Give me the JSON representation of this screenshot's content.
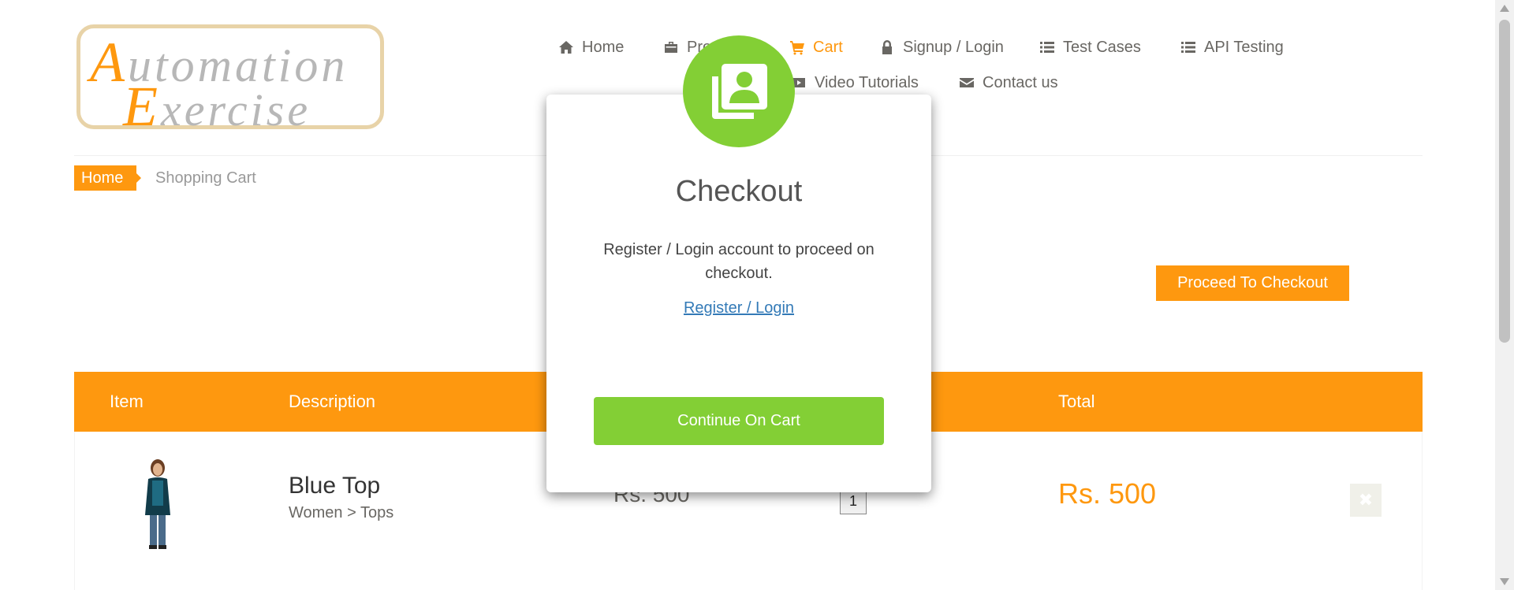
{
  "logo": {
    "line1_cap": "A",
    "line1_rest": "utomation",
    "line2_cap": "E",
    "line2_rest": "xercise"
  },
  "nav": {
    "home": "Home",
    "products": "Products",
    "cart": "Cart",
    "signup_login": "Signup / Login",
    "test_cases": "Test Cases",
    "api_testing": "API Testing",
    "video_tutorials": "Video Tutorials",
    "contact_us": "Contact us"
  },
  "breadcrumb": {
    "home": "Home",
    "current": "Shopping Cart"
  },
  "proceed_button": "Proceed To Checkout",
  "table": {
    "headers": {
      "item": "Item",
      "description": "Description",
      "total": "Total"
    },
    "rows": [
      {
        "name": "Blue Top",
        "category": "Women > Tops",
        "price": "Rs. 500",
        "quantity": "1",
        "total": "Rs. 500"
      }
    ]
  },
  "modal": {
    "title": "Checkout",
    "body": "Register / Login account to proceed on checkout.",
    "link": "Register / Login",
    "continue_button": "Continue On Cart"
  },
  "colors": {
    "brand_orange": "#fe980f",
    "modal_green": "#83cf35",
    "link_blue": "#337ab7"
  },
  "icons": {
    "home": "home-icon",
    "products": "briefcase-icon",
    "cart": "shopping-cart-icon",
    "signup": "lock-icon",
    "test_cases": "list-icon",
    "api": "list-icon",
    "video": "youtube-play-icon",
    "contact": "envelope-icon",
    "modal": "address-book-icon",
    "delete": "close-icon"
  }
}
